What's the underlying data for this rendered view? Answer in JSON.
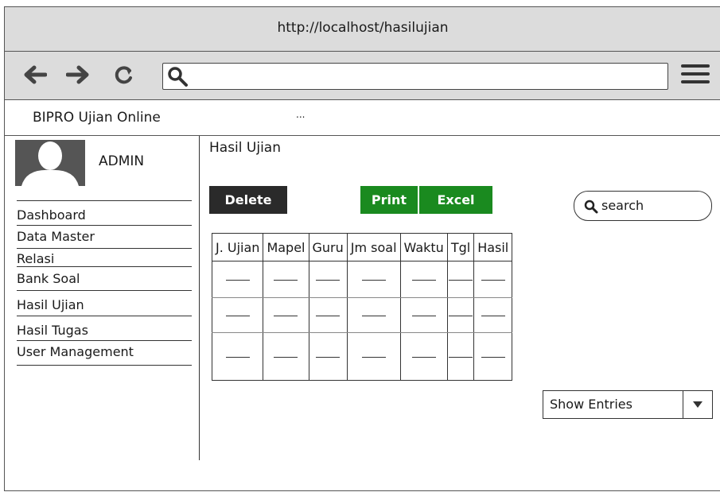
{
  "browser": {
    "url": "http://localhost/hasilujian",
    "address_value": ""
  },
  "app": {
    "name": "BIPRO Ujian Online",
    "tab_extra": "..."
  },
  "user": {
    "name": "ADMIN"
  },
  "sidebar": {
    "items": [
      {
        "label": "Dashboard"
      },
      {
        "label": "Data Master"
      },
      {
        "label": "Relasi"
      },
      {
        "label": "Bank Soal"
      },
      {
        "label": "Hasil Ujian"
      },
      {
        "label": "Hasil Tugas"
      },
      {
        "label": "User Management"
      }
    ]
  },
  "page": {
    "title": "Hasil Ujian"
  },
  "toolbar": {
    "delete_label": "Delete",
    "print_label": "Print",
    "excel_label": "Excel",
    "search_placeholder": "search"
  },
  "table": {
    "columns": [
      "J. Ujian",
      "Mapel",
      "Guru",
      "Jm soal",
      "Waktu",
      "Tgl",
      "Hasil"
    ],
    "row_count": 3
  },
  "pagination": {
    "entries_label": "Show Entries"
  },
  "colors": {
    "accent_green": "#1a8a1f",
    "dark_button": "#2a2a2a",
    "chrome_gray": "#dcdcdc"
  }
}
